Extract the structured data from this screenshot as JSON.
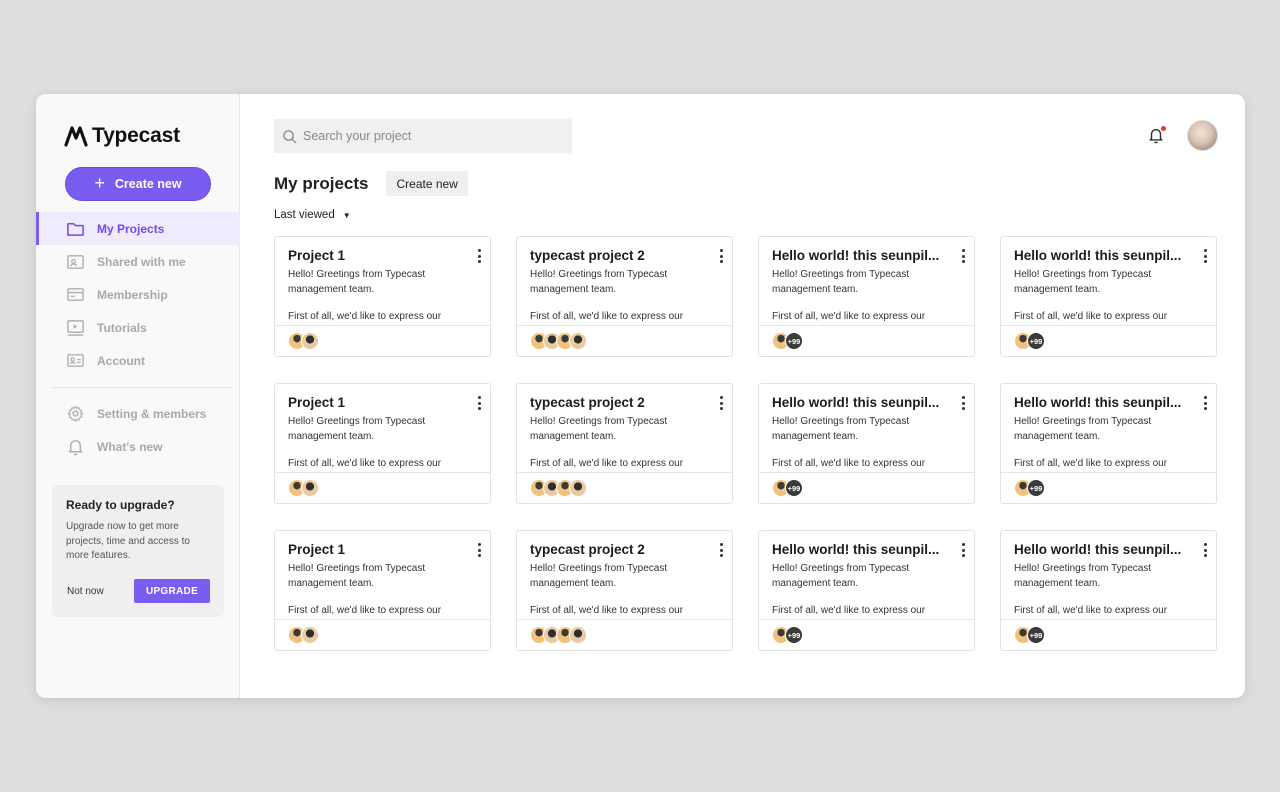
{
  "app": {
    "logo_text": "Typecast"
  },
  "sidebar": {
    "create_label": "Create new",
    "items": [
      {
        "label": "My Projects",
        "icon": "folder-icon",
        "active": true
      },
      {
        "label": "Shared with me",
        "icon": "shared-icon",
        "active": false
      },
      {
        "label": "Membership",
        "icon": "card-icon",
        "active": false
      },
      {
        "label": "Tutorials",
        "icon": "video-icon",
        "active": false
      },
      {
        "label": "Account",
        "icon": "id-card-icon",
        "active": false
      }
    ],
    "secondary": [
      {
        "label": "Setting & members",
        "icon": "gear-icon"
      },
      {
        "label": "What's new",
        "icon": "bell-icon"
      }
    ],
    "upgrade": {
      "title": "Ready to upgrade?",
      "text": "Upgrade now to get more projects, time and access to more features.",
      "dismiss_label": "Not now",
      "button_label": "UPGRADE"
    }
  },
  "header": {
    "search_placeholder": "Search your project"
  },
  "main": {
    "title": "My projects",
    "create_label": "Create new",
    "sort_label": "Last viewed",
    "cards": [
      {
        "title": "Project 1",
        "desc": "Hello! Greetings from Typecast management team.",
        "desc2": "First of all, we'd like to express our",
        "avatars": 2,
        "more": ""
      },
      {
        "title": "typecast project 2",
        "desc": "Hello! Greetings from Typecast management team.",
        "desc2": "First of all, we'd like to express our",
        "avatars": 4,
        "more": ""
      },
      {
        "title": "Hello world! this seunpil...",
        "desc": "Hello! Greetings from Typecast management team.",
        "desc2": "First of all, we'd like to express our",
        "avatars": 1,
        "more": "+99"
      },
      {
        "title": "Hello world! this seunpil...",
        "desc": "Hello! Greetings from Typecast management team.",
        "desc2": "First of all, we'd like to express our",
        "avatars": 1,
        "more": "+99"
      },
      {
        "title": "Project 1",
        "desc": "Hello! Greetings from Typecast management team.",
        "desc2": "First of all, we'd like to express our",
        "avatars": 2,
        "more": ""
      },
      {
        "title": "typecast project 2",
        "desc": "Hello! Greetings from Typecast management team.",
        "desc2": "First of all, we'd like to express our",
        "avatars": 4,
        "more": ""
      },
      {
        "title": "Hello world! this seunpil...",
        "desc": "Hello! Greetings from Typecast management team.",
        "desc2": "First of all, we'd like to express our",
        "avatars": 1,
        "more": "+99"
      },
      {
        "title": "Hello world! this seunpil...",
        "desc": "Hello! Greetings from Typecast management team.",
        "desc2": "First of all, we'd like to express our",
        "avatars": 1,
        "more": "+99"
      },
      {
        "title": "Project 1",
        "desc": "Hello! Greetings from Typecast management team.",
        "desc2": "First of all, we'd like to express our",
        "avatars": 2,
        "more": ""
      },
      {
        "title": "typecast project 2",
        "desc": "Hello! Greetings from Typecast management team.",
        "desc2": "First of all, we'd like to express our",
        "avatars": 4,
        "more": ""
      },
      {
        "title": "Hello world! this seunpil...",
        "desc": "Hello! Greetings from Typecast management team.",
        "desc2": "First of all, we'd like to express our",
        "avatars": 1,
        "more": "+99"
      },
      {
        "title": "Hello world! this seunpil...",
        "desc": "Hello! Greetings from Typecast management team.",
        "desc2": "First of all, we'd like to express our",
        "avatars": 1,
        "more": "+99"
      }
    ]
  },
  "colors": {
    "accent": "#7b5cf0",
    "active_bg": "#efebfd",
    "notification_dot": "#e53935"
  }
}
